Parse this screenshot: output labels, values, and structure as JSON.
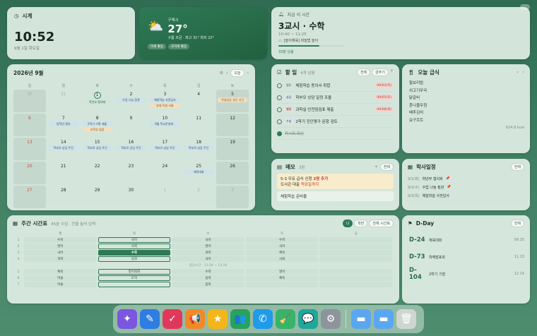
{
  "clock": {
    "title": "시계",
    "time": "10:52",
    "date": "9월 1일 화요일"
  },
  "weather": {
    "location": "구래시",
    "temp": "27°",
    "desc": "구름 조금 · 최고 31° 최저 22°",
    "tags": [
      "미세 좋음",
      "초미세 좋음"
    ]
  },
  "now_class": {
    "label": "지금 이 시간",
    "title": "3교시 · 수학",
    "range": "10:40 ~ 11:25",
    "activity": "[놀이체육] 비밀법 놀이",
    "remaining": "33분 남음",
    "progress": 0.62
  },
  "calendar": {
    "title": "2026년 9월",
    "today_btn": "오늘",
    "dows": [
      "일",
      "월",
      "화",
      "수",
      "목",
      "금",
      "토"
    ],
    "weeks": [
      [
        {
          "d": "30",
          "o": true
        },
        {
          "d": "31",
          "o": true
        },
        {
          "d": "1",
          "today": true,
          "ev": [
            [
              "학년부 협의회",
              "green"
            ]
          ]
        },
        {
          "d": "2",
          "ev": [
            [
              "수업 나눔 참관",
              "blue"
            ]
          ]
        },
        {
          "d": "3",
          "ev": [
            [
              "체험학습 사전답사",
              "blue"
            ],
            [
              "영재 학생 서통",
              "orange"
            ]
          ]
        },
        {
          "d": "4"
        },
        {
          "d": "5",
          "ev": [
            [
              "학생상담 실무 기간",
              "orange"
            ]
          ]
        }
      ],
      [
        {
          "d": "6"
        },
        {
          "d": "7",
          "ev": [
            [
              "동학년 협의",
              "blue"
            ]
          ]
        },
        {
          "d": "8",
          "ev": [
            [
              "2학기 기획 제출",
              "blue"
            ],
            [
              "과학실 점검",
              "orange"
            ]
          ]
        },
        {
          "d": "9"
        },
        {
          "d": "10",
          "ev": [
            [
              "9월 학교운영위..",
              "blue"
            ]
          ]
        },
        {
          "d": "11"
        },
        {
          "d": "12"
        }
      ],
      [
        {
          "d": "13"
        },
        {
          "d": "14",
          "ev": [
            [
              "학부모 상담 주간",
              "blue"
            ]
          ]
        },
        {
          "d": "15",
          "ev": [
            [
              "학부모 상담 주간",
              "blue"
            ]
          ]
        },
        {
          "d": "16",
          "ev": [
            [
              "학부모 상담 주간",
              "blue"
            ]
          ]
        },
        {
          "d": "17",
          "ev": [
            [
              "학부모 상담 주간",
              "blue"
            ]
          ]
        },
        {
          "d": "18",
          "ev": [
            [
              "학부모 상담 주간",
              "blue"
            ]
          ]
        },
        {
          "d": "19"
        }
      ],
      [
        {
          "d": "20"
        },
        {
          "d": "21"
        },
        {
          "d": "22"
        },
        {
          "d": "23"
        },
        {
          "d": "24"
        },
        {
          "d": "25",
          "ev": [
            [
              "체육대회",
              "blue"
            ]
          ]
        },
        {
          "d": "26"
        }
      ],
      [
        {
          "d": "27"
        },
        {
          "d": "28"
        },
        {
          "d": "29"
        },
        {
          "d": "30"
        },
        {
          "d": "1",
          "o": true
        },
        {
          "d": "2",
          "o": true
        },
        {
          "d": "3",
          "o": true
        }
      ]
    ]
  },
  "todo": {
    "title": "할 일",
    "count": "4개 남음",
    "filters": [
      "전체",
      "금주기"
    ],
    "items": [
      {
        "cat": "업무",
        "catColor": "#d6e8d8",
        "text": "체험학습 동의서 취합",
        "due": "09/03(목)"
      },
      {
        "cat": "상담",
        "catColor": "#d9e6f0",
        "text": "학부모 상담 일정 조율",
        "due": "09/05(토)"
      },
      {
        "cat": "행정",
        "catColor": "#f0dcd9",
        "text": "과학실 안전점검표 제출",
        "due": "09/08(화)"
      },
      {
        "cat": "수업",
        "catColor": "#dfe3f2",
        "text": "2학기 진단평가 문항 검토",
        "due": ""
      },
      {
        "cat": "",
        "catColor": "",
        "text": "독서록 확인",
        "due": "",
        "done": true
      }
    ]
  },
  "lunch": {
    "title": "오늘 급식",
    "items": [
      "찰보리밥",
      "쇠고기무국",
      "닭갈비",
      "흔나물무침",
      "배추김치",
      "요구르트"
    ],
    "kcal": "624.8 kcal"
  },
  "memo": {
    "title": "메모",
    "count": "3장",
    "filter": "전체",
    "notes": [
      {
        "l1a": "5-3 우유 급식 신청 ",
        "l1b": "2명 추가",
        "l2a": "도서관 대출 ",
        "l2b": "독묘일까지",
        "bg": "#f8eccb"
      },
      {
        "l1a": "체험학습 준비물",
        "l1b": "",
        "l2a": "",
        "l2b": "",
        "bg": "#e9f1ec"
      }
    ]
  },
  "schedule": {
    "title": "학사일정",
    "filter": "전체",
    "items": [
      {
        "date": "9/1(화)",
        "text": "학년부 협의회",
        "pin": true
      },
      {
        "date": "9/2(수)",
        "text": "수업 나눔 참관",
        "pin": true
      },
      {
        "date": "9/3(목)",
        "text": "체험학습 사전답사",
        "pin": false
      }
    ]
  },
  "timetable": {
    "title": "주간 시간표",
    "sub": "45분 수업 · 칸을 눌러 입력",
    "tabs": [
      "나",
      "학반",
      "전체 시간표"
    ],
    "days": [
      "월",
      "화",
      "수",
      "목",
      "금"
    ],
    "rows": [
      {
        "p": "1",
        "c": [
          "수학",
          "국어",
          "국어",
          "수학",
          ""
        ]
      },
      {
        "p": "2",
        "c": [
          "영어",
          "사회",
          "영어",
          "국어",
          ""
        ]
      },
      {
        "p": "3",
        "c": [
          "국어",
          "수학",
          "과학",
          "체육",
          ""
        ]
      },
      {
        "p": "4",
        "c": [
          "과학",
          "실과",
          "국어",
          "사회",
          ""
        ]
      },
      {
        "p": "5",
        "c": [
          "체육",
          "영어회화",
          "수학",
          "영어",
          ""
        ]
      },
      {
        "p": "6",
        "c": [
          "미술",
          "도덕",
          "음악",
          "체육",
          ""
        ]
      },
      {
        "p": "7",
        "c": [
          "미술",
          "",
          "음악",
          "",
          ""
        ]
      }
    ],
    "lunch_label": "점심시간 · 12:20 ~ 13:10"
  },
  "dday": {
    "title": "D-Day",
    "filter": "전체",
    "items": [
      {
        "n": "D-24",
        "t": "체육대회",
        "d": "09.25"
      },
      {
        "n": "D-73",
        "t": "학예발표회",
        "d": "11.13"
      },
      {
        "n": "D-104",
        "t": "2학기 기말",
        "d": "12.14"
      }
    ]
  },
  "dock": {
    "apps": [
      {
        "name": "sparkle-app",
        "glyph": "✦",
        "color": "#7b57e0"
      },
      {
        "name": "pen-app",
        "glyph": "✎",
        "color": "#2f7de1"
      },
      {
        "name": "checklist-app",
        "glyph": "✓",
        "color": "#e0385a"
      },
      {
        "name": "megaphone-app",
        "glyph": "📢",
        "color": "#f08a24"
      },
      {
        "name": "star-app",
        "glyph": "★",
        "color": "#f2b51c"
      },
      {
        "name": "people-app",
        "glyph": "👥",
        "color": "#29a35a"
      },
      {
        "name": "phone-app",
        "glyph": "✆",
        "color": "#1f9be8"
      },
      {
        "name": "broom-app",
        "glyph": "🧹",
        "color": "#39b36a"
      },
      {
        "name": "chat-app",
        "glyph": "💬",
        "color": "#1fa79a"
      },
      {
        "name": "settings-app",
        "glyph": "⚙",
        "color": "#8d949b"
      }
    ],
    "right": [
      {
        "name": "folder-app",
        "glyph": "▬",
        "color": "#5ba7ef"
      },
      {
        "name": "folder2-app",
        "glyph": "▬",
        "color": "#5ba7ef"
      },
      {
        "name": "trash-app",
        "glyph": "🗑",
        "color": "#cfd6d2"
      }
    ]
  }
}
